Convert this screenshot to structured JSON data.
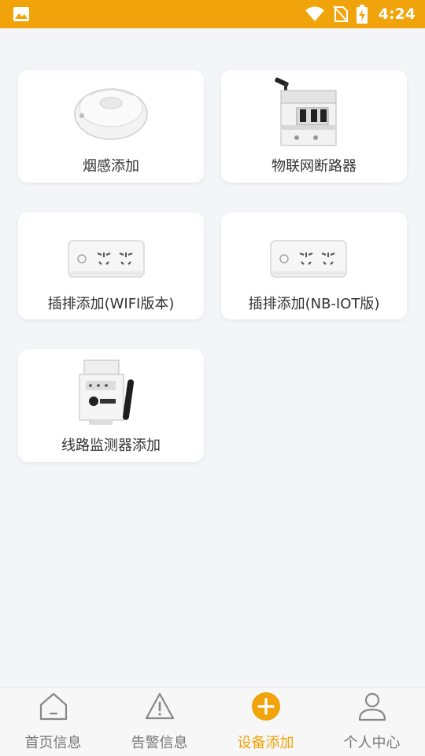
{
  "status_bar": {
    "time": "4:24"
  },
  "devices": [
    {
      "label": "烟感添加",
      "image": "smoke-detector"
    },
    {
      "label": "物联网断路器",
      "image": "iot-circuit-breaker"
    },
    {
      "label": "插排添加(WIFI版本)",
      "image": "power-strip"
    },
    {
      "label": "插排添加(NB-IOT版)",
      "image": "power-strip"
    },
    {
      "label": "线路监测器添加",
      "image": "line-monitor"
    }
  ],
  "tab_bar": {
    "tabs": [
      {
        "label": "首页信息",
        "icon": "home-icon"
      },
      {
        "label": "告警信息",
        "icon": "warning-icon"
      },
      {
        "label": "设备添加",
        "icon": "add-circle-icon",
        "active": true
      },
      {
        "label": "个人中心",
        "icon": "user-icon"
      }
    ]
  },
  "colors": {
    "accent": "#f0a30a",
    "background": "#f4f5f9"
  }
}
